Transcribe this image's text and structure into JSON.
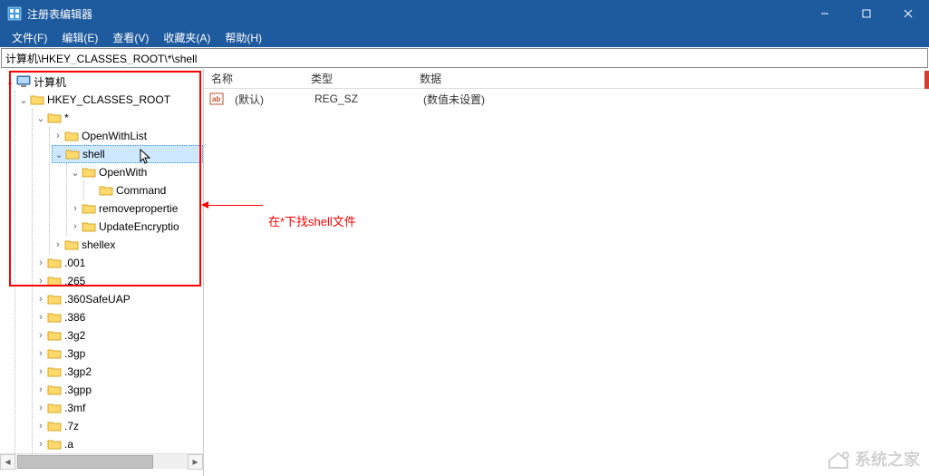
{
  "title": "注册表编辑器",
  "menu": {
    "file": "文件(F)",
    "edit": "编辑(E)",
    "view": "查看(V)",
    "favorites": "收藏夹(A)",
    "help": "帮助(H)"
  },
  "address_path": "计算机\\HKEY_CLASSES_ROOT\\*\\shell",
  "tree": {
    "root": "计算机",
    "hkcr": "HKEY_CLASSES_ROOT",
    "star": "*",
    "items_under_star": {
      "OpenWithList": "OpenWithList",
      "shell": "shell",
      "OpenWith": "OpenWith",
      "Command": "Command",
      "removeproperties": "removepropertie",
      "UpdateEncryption": "UpdateEncryptio",
      "shellex": "shellex"
    },
    "ext_list": [
      ".001",
      ".265",
      ".360SafeUAP",
      ".386",
      ".3g2",
      ".3gp",
      ".3gp2",
      ".3gpp",
      ".3mf",
      ".7z",
      ".a"
    ]
  },
  "list": {
    "headers": {
      "name": "名称",
      "type": "类型",
      "data": "数据"
    },
    "rows": [
      {
        "name": "(默认)",
        "type": "REG_SZ",
        "data": "(数值未设置)"
      }
    ]
  },
  "annotation_text": "在*下找shell文件",
  "watermark_text": "系统之家"
}
